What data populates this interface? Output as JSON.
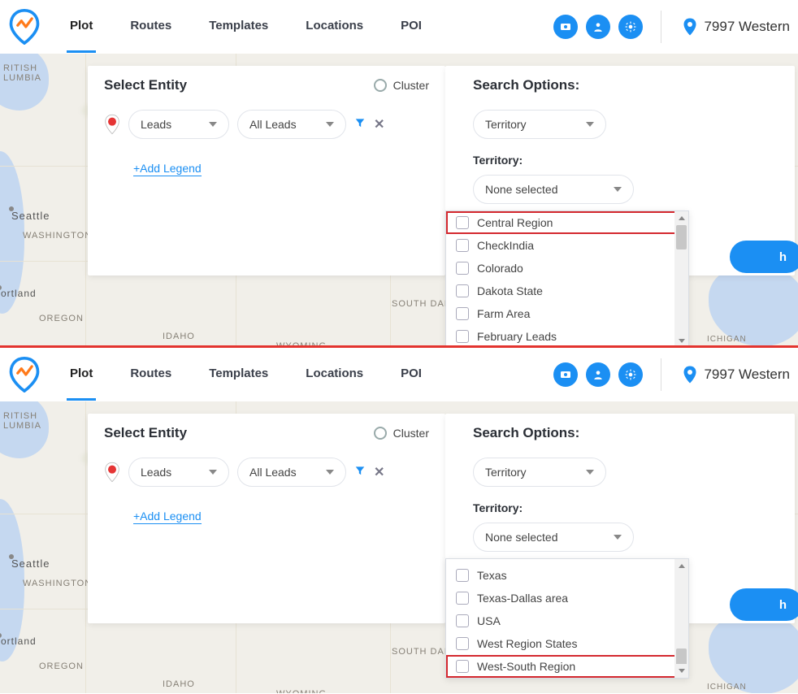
{
  "nav": {
    "tabs": [
      "Plot",
      "Routes",
      "Templates",
      "Locations",
      "POI"
    ],
    "address": "7997 Western"
  },
  "left": {
    "title": "Select Entity",
    "cluster_label": "Cluster",
    "dd1": "Leads",
    "dd2": "All Leads",
    "add_legend": "+Add Legend"
  },
  "right": {
    "title": "Search Options:",
    "search_by": "Territory",
    "section": "Territory:",
    "territory_selected": "None selected"
  },
  "territory_options_top": [
    {
      "label": "Central Region",
      "highlight": true
    },
    {
      "label": "CheckIndia"
    },
    {
      "label": "Colorado"
    },
    {
      "label": "Dakota State"
    },
    {
      "label": "Farm Area"
    },
    {
      "label": "February Leads"
    }
  ],
  "territory_options_bottom": [
    {
      "label": "Texas"
    },
    {
      "label": "Texas-Dallas area"
    },
    {
      "label": "USA"
    },
    {
      "label": "West Region States"
    },
    {
      "label": "West-South Region",
      "highlight": true
    }
  ],
  "search_btn": "h",
  "map_labels": {
    "bc": "RITISH\nLUMBIA",
    "seattle": "Seattle",
    "wa": "WASHINGTON",
    "portland": "ortland",
    "oregon": "OREGON",
    "idaho": "IDAHO",
    "wyoming": "WYOMING",
    "sdakota": "SOUTH DAKOTA",
    "michigan": "ICHIGAN"
  }
}
